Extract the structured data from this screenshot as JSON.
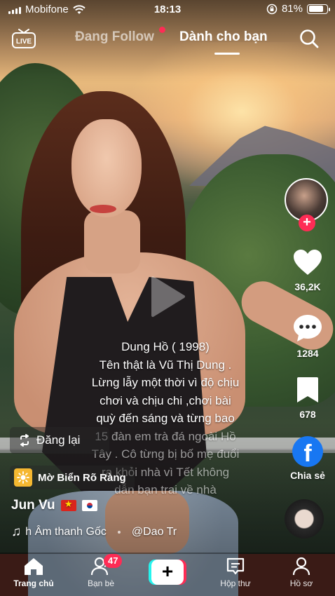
{
  "status_bar": {
    "carrier": "Mobifone",
    "time": "18:13",
    "battery_percent": "81%",
    "battery_level": 0.81
  },
  "top_nav": {
    "live_label": "LIVE",
    "tab_following": "Đang Follow",
    "tab_for_you": "Dành cho bạn",
    "active_tab": "for_you",
    "has_notification_dot": true
  },
  "right_rail": {
    "likes": "36,2K",
    "comments": "1284",
    "saves": "678",
    "share_label": "Chia sẻ",
    "facebook_letter": "f"
  },
  "caption": {
    "lines": [
      "Dung Hồ ( 1998)",
      "Tên thật là Vũ Thị Dung .",
      "Lừng lẫy một thời vì độ chịu",
      "chơi và chịu chi ,chơi bài",
      "quỳ đến sáng và từng bao"
    ],
    "faded_lines": [
      "15 đàn em trà đá ngoài Hồ",
      "Tây . Cô từng bị bố mẹ đuổi",
      "ra khỏi nhà vì Tết không",
      "dẫn bạn trai về nhà"
    ]
  },
  "repost": {
    "label": "Đăng lại"
  },
  "effect": {
    "label": "Mờ Biển Rõ Ràng"
  },
  "author": {
    "username": "Jun Vu"
  },
  "music": {
    "title": "h Âm thanh Gốc",
    "artist": "@Dao Tr"
  },
  "bottom_nav": {
    "home": "Trang chủ",
    "friends": "Bạn bè",
    "friends_badge": "47",
    "inbox": "Hộp thư",
    "profile": "Hồ sơ",
    "create_symbol": "+"
  },
  "colors": {
    "accent_red": "#fe2c55",
    "accent_cyan": "#25f4ee",
    "facebook_blue": "#1877f2",
    "effect_yellow": "#f5b731"
  }
}
